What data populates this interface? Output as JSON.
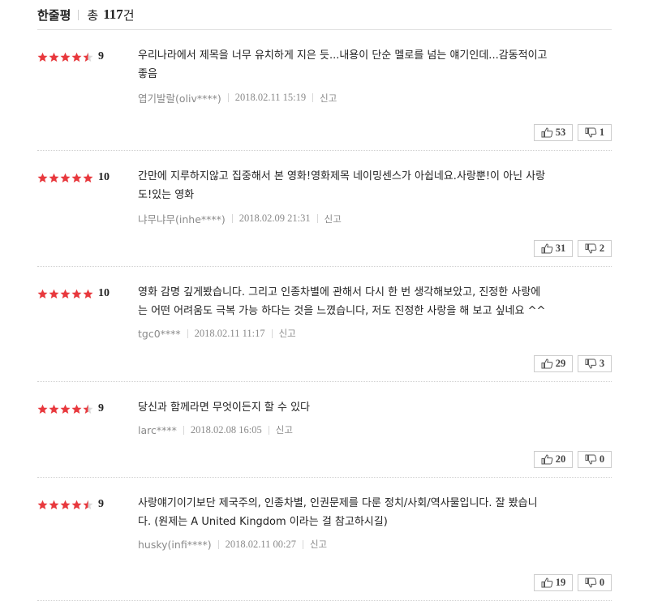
{
  "header": {
    "title": "한줄평",
    "total_prefix": "총",
    "total_count": "117",
    "total_suffix": "건"
  },
  "colors": {
    "star": "#e8383d",
    "star_empty": "#d9d9d9"
  },
  "reviews": [
    {
      "stars": 4.5,
      "score": "9",
      "lines": [
        "우리나라에서 제목을 너무 유치하게 지은 듯...내용이 단순 멜로를 넘는 얘기인데...감동적이고",
        "좋음"
      ],
      "nickname": "엽기발랄(oliv****)",
      "date": "2018.02.11 15:19",
      "report": "신고",
      "likes": "53",
      "dislikes": "1"
    },
    {
      "stars": 5,
      "score": "10",
      "lines": [
        "간만에 지루하지않고 집중해서 본 영화!영화제목 네이밍센스가 아쉽네요.사랑뿐!이 아닌 사랑",
        "도!있는 영화"
      ],
      "nickname": "냐무냐무(inhe****)",
      "date": "2018.02.09 21:31",
      "report": "신고",
      "likes": "31",
      "dislikes": "2"
    },
    {
      "stars": 5,
      "score": "10",
      "lines": [
        "영화 감명 깊게봤습니다. 그리고 인종차별에 관해서 다시 한 번 생각해보았고, 진정한 사랑에",
        "는 어떤 어려움도 극복 가능 하다는 것을 느꼈습니다, 저도 진정한 사랑을 해 보고 싶네요 ^^"
      ],
      "nickname": "tgc0****",
      "date": "2018.02.11 11:17",
      "report": "신고",
      "likes": "29",
      "dislikes": "3"
    },
    {
      "stars": 4.5,
      "score": "9",
      "lines": [
        "당신과 함께라면 무엇이든지 할 수 있다"
      ],
      "nickname": "larc****",
      "date": "2018.02.08 16:05",
      "report": "신고",
      "likes": "20",
      "dislikes": "0"
    },
    {
      "stars": 4.5,
      "score": "9",
      "lines": [
        "사랑얘기이기보단 제국주의, 인종차별, 인권문제를 다룬 정치/사회/역사물입니다. 잘 봤습니",
        "다. (원제는 A United Kingdom 이라는 걸 참고하시길)"
      ],
      "nickname": "husky(infi****)",
      "date": "2018.02.11 00:27",
      "report": "신고",
      "likes": "19",
      "dislikes": "0"
    }
  ]
}
